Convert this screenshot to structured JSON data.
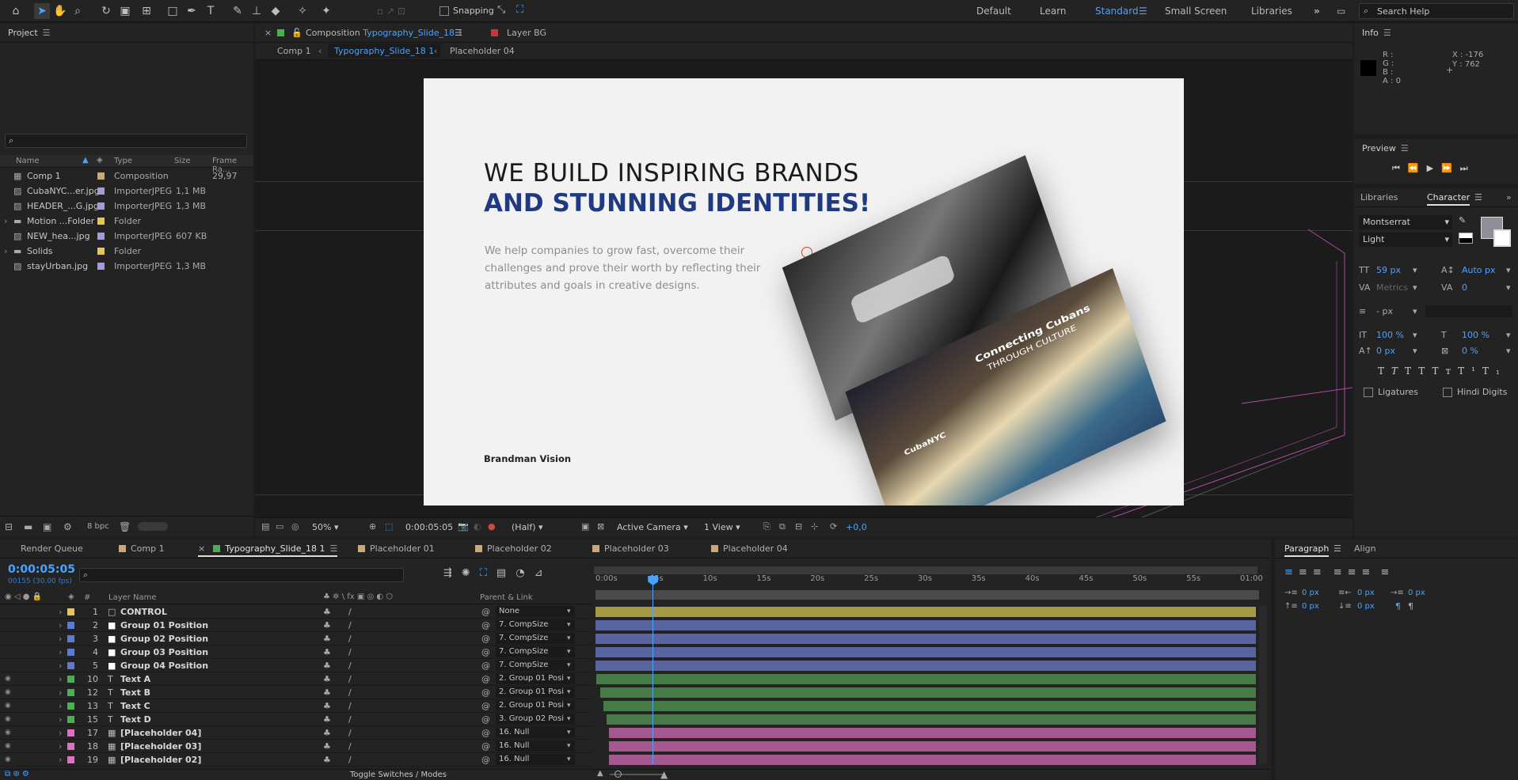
{
  "toolbar": {
    "snapping_label": "Snapping",
    "workspaces": [
      "Default",
      "Learn",
      "Standard",
      "Small Screen",
      "Libraries"
    ],
    "active_workspace": "Standard",
    "search_placeholder": "Search Help"
  },
  "project": {
    "title": "Project",
    "columns": [
      "Name",
      "Type",
      "Size",
      "Frame Ra..."
    ],
    "items": [
      {
        "name": "Comp 1",
        "label_color": "#c9a97a",
        "type": "Composition",
        "size": "",
        "frame_rate": "29,97",
        "icon": "composition-icon"
      },
      {
        "name": "CubaNYC...er.jpg",
        "label_color": "#a89ad6",
        "type": "ImporterJPEG",
        "size": "1,1 MB",
        "frame_rate": "",
        "icon": "image-file-icon"
      },
      {
        "name": "HEADER_...G.jpg",
        "label_color": "#a89ad6",
        "type": "ImporterJPEG",
        "size": "1,3 MB",
        "frame_rate": "",
        "icon": "image-file-icon"
      },
      {
        "name": "Motion ...Folder",
        "label_color": "#e8c64a",
        "type": "Folder",
        "size": "",
        "frame_rate": "",
        "icon": "folder-icon"
      },
      {
        "name": "NEW_hea...jpg",
        "label_color": "#a89ad6",
        "type": "ImporterJPEG",
        "size": "607 KB",
        "frame_rate": "",
        "icon": "image-file-icon"
      },
      {
        "name": "Solids",
        "label_color": "#e8c64a",
        "type": "Folder",
        "size": "",
        "frame_rate": "",
        "icon": "folder-icon"
      },
      {
        "name": "stayUrban.jpg",
        "label_color": "#a89ad6",
        "type": "ImporterJPEG",
        "size": "1,3 MB",
        "frame_rate": "",
        "icon": "image-file-icon"
      }
    ],
    "bpc": "8 bpc"
  },
  "composition": {
    "tab_prefix": "Composition",
    "tab_name": "Typography_Slide_18 1",
    "layer_tab": "Layer BG",
    "breadcrumbs": [
      "Comp 1",
      "Typography_Slide_18 1",
      "Placeholder 04"
    ],
    "headline1": "WE BUILD INSPIRING BRANDS",
    "headline2": "AND STUNNING IDENTITIES!",
    "body": "We help companies to grow fast, overcome their challenges and prove their worth by reflecting their attributes and goals in creative designs.",
    "brand": "Brandman Vision",
    "card_text1": "Connecting Cubans",
    "card_text2": "THROUGH CULTURE",
    "card_logo": "CubaNYC"
  },
  "viewer_bar": {
    "zoom": "50%",
    "timecode": "0:00:05:05",
    "resolution": "(Half)",
    "camera": "Active Camera",
    "views": "1 View",
    "exposure": "+0,0"
  },
  "info": {
    "title": "Info",
    "r": "R :",
    "g": "G :",
    "b": "B :",
    "a": "A :  0",
    "x": "X : -176",
    "y": "Y : 762"
  },
  "preview": {
    "title": "Preview"
  },
  "character": {
    "tab_libraries": "Libraries",
    "tab_character": "Character",
    "font": "Montserrat",
    "style": "Light",
    "size": "59 px",
    "leading": "Auto px",
    "kerning": "Metrics",
    "tracking": "0",
    "stroke": "- px",
    "vscale": "100 %",
    "hscale": "100 %",
    "baseline": "0 px",
    "tsume": "0 %",
    "ligatures": "Ligatures",
    "hindi": "Hindi Digits",
    "fill_color": "#8e8e98"
  },
  "timeline": {
    "tabs": [
      {
        "label": "Render Queue",
        "color": ""
      },
      {
        "label": "Comp 1",
        "color": "#c9a97a"
      },
      {
        "label": "Typography_Slide_18 1",
        "color": "#4caf50"
      },
      {
        "label": "Placeholder 01",
        "color": "#c9a97a"
      },
      {
        "label": "Placeholder 02",
        "color": "#c9a97a"
      },
      {
        "label": "Placeholder 03",
        "color": "#c9a97a"
      },
      {
        "label": "Placeholder 04",
        "color": "#c9a97a"
      }
    ],
    "timecode": "0:00:05:05",
    "fps": "00155 (30.00 fps)",
    "col_hash": "#",
    "col_layer": "Layer Name",
    "col_parent": "Parent & Link",
    "ticks": [
      "0:00s",
      "05s",
      "10s",
      "15s",
      "20s",
      "25s",
      "30s",
      "35s",
      "40s",
      "45s",
      "50s",
      "55s",
      "01:00"
    ],
    "playhead_seconds": 5.17,
    "duration_seconds": 60,
    "layers": [
      {
        "num": "1",
        "name": "CONTROL",
        "color": "#e8c64a",
        "icon": "null-object-icon",
        "parent": "None",
        "bar_color": "#a69a47",
        "start": 0,
        "visible": false
      },
      {
        "num": "2",
        "name": "Group 01 Position",
        "color": "#5c7bd6",
        "icon": "solid-white-icon",
        "parent": "7. CompSize",
        "bar_color": "#5865a0",
        "start": 0,
        "visible": false
      },
      {
        "num": "3",
        "name": "Group 02 Position",
        "color": "#5c7bd6",
        "icon": "solid-white-icon",
        "parent": "7. CompSize",
        "bar_color": "#5865a0",
        "start": 0,
        "visible": false
      },
      {
        "num": "4",
        "name": "Group 03 Position",
        "color": "#5c7bd6",
        "icon": "solid-white-icon",
        "parent": "7. CompSize",
        "bar_color": "#5865a0",
        "start": 0,
        "visible": false
      },
      {
        "num": "5",
        "name": "Group 04 Position",
        "color": "#5c7bd6",
        "icon": "solid-white-icon",
        "parent": "7. CompSize",
        "bar_color": "#5865a0",
        "start": 0,
        "visible": false
      },
      {
        "num": "10",
        "name": "Text A",
        "color": "#4caf50",
        "icon": "text-layer-icon",
        "parent": "2. Group 01 Posi",
        "bar_color": "#467a46",
        "start": 0.1,
        "visible": true
      },
      {
        "num": "12",
        "name": "Text B",
        "color": "#4caf50",
        "icon": "text-layer-icon",
        "parent": "2. Group 01 Posi",
        "bar_color": "#467a46",
        "start": 0.4,
        "visible": true
      },
      {
        "num": "13",
        "name": "Text C",
        "color": "#4caf50",
        "icon": "text-layer-icon",
        "parent": "2. Group 01 Posi",
        "bar_color": "#467a46",
        "start": 0.7,
        "visible": true
      },
      {
        "num": "15",
        "name": "Text D",
        "color": "#4caf50",
        "icon": "text-layer-icon",
        "parent": "3. Group 02 Posi",
        "bar_color": "#467a46",
        "start": 1.0,
        "visible": true
      },
      {
        "num": "17",
        "name": "[Placeholder 04]",
        "color": "#e070c0",
        "icon": "precomp-icon",
        "parent": "16. Null",
        "bar_color": "#a5578f",
        "start": 1.2,
        "visible": true
      },
      {
        "num": "18",
        "name": "[Placeholder 03]",
        "color": "#e070c0",
        "icon": "precomp-icon",
        "parent": "16. Null",
        "bar_color": "#a5578f",
        "start": 1.2,
        "visible": true
      },
      {
        "num": "19",
        "name": "[Placeholder 02]",
        "color": "#e070c0",
        "icon": "precomp-icon",
        "parent": "16. Null",
        "bar_color": "#a5578f",
        "start": 1.2,
        "visible": true
      }
    ],
    "toggle_label": "Toggle Switches / Modes"
  },
  "paragraph": {
    "tab_paragraph": "Paragraph",
    "tab_align": "Align",
    "indent_left": "0 px",
    "indent_first": "0 px",
    "indent_right": "0 px",
    "space_before": "0 px",
    "space_after": "0 px"
  }
}
